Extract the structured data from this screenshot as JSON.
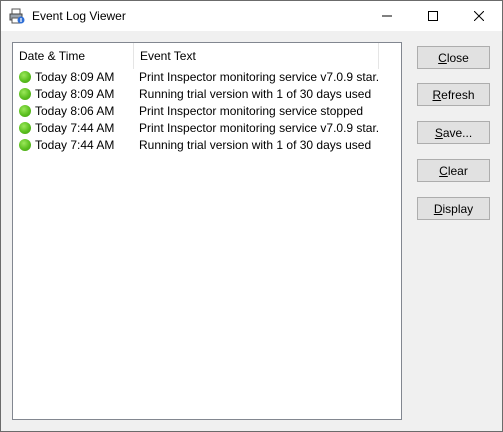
{
  "window": {
    "title": "Event Log Viewer",
    "controls": {
      "minimize": "minimize-icon",
      "maximize": "maximize-icon",
      "close": "close-icon"
    }
  },
  "list": {
    "columns": [
      "Date & Time",
      "Event Text"
    ],
    "rows": [
      {
        "status": "ok",
        "time": "Today 8:09 AM",
        "text": "Print Inspector monitoring service v7.0.9 star..."
      },
      {
        "status": "ok",
        "time": "Today 8:09 AM",
        "text": "Running trial version with 1 of 30 days used"
      },
      {
        "status": "ok",
        "time": "Today 8:06 AM",
        "text": "Print Inspector monitoring service stopped"
      },
      {
        "status": "ok",
        "time": "Today 7:44 AM",
        "text": "Print Inspector monitoring service v7.0.9 star..."
      },
      {
        "status": "ok",
        "time": "Today 7:44 AM",
        "text": "Running trial version with 1 of 30 days used"
      }
    ]
  },
  "buttons": {
    "close": {
      "hotkey": "C",
      "rest": "lose"
    },
    "refresh": {
      "hotkey": "R",
      "rest": "efresh"
    },
    "save": {
      "hotkey": "S",
      "rest": "ave..."
    },
    "clear": {
      "hotkey": "C",
      "rest": "lear"
    },
    "display": {
      "hotkey": "D",
      "rest": "isplay"
    }
  },
  "colors": {
    "status_ok": "#5bbf1f",
    "button_face": "#e1e1e1",
    "border": "#828790"
  }
}
